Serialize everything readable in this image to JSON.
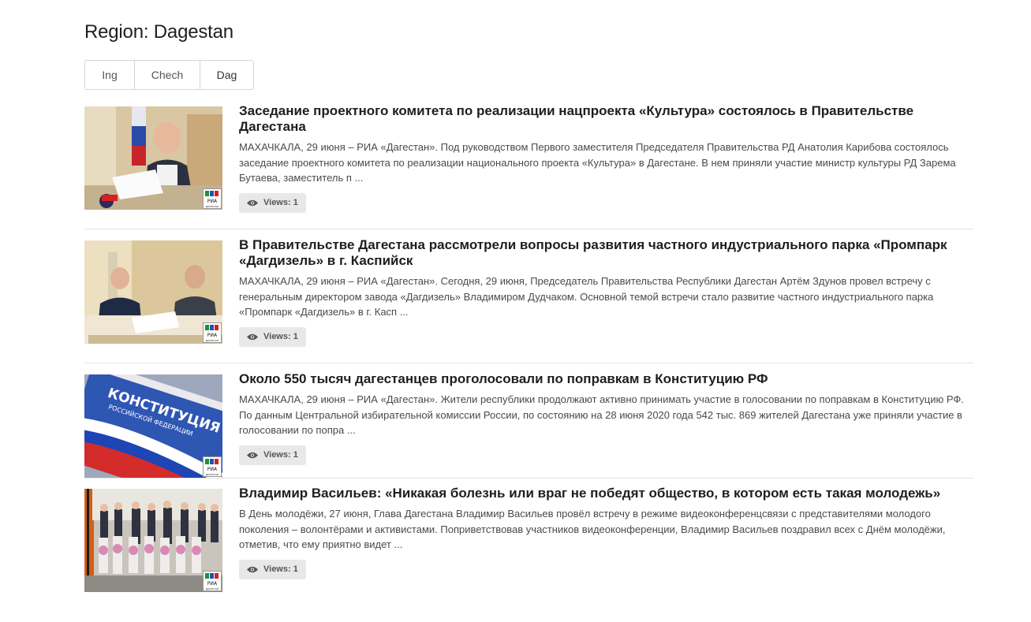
{
  "page": {
    "title": "Region: Dagestan"
  },
  "tabs": [
    {
      "label": "Ing"
    },
    {
      "label": "Chech"
    },
    {
      "label": "Dag"
    }
  ],
  "logo": {
    "colors": [
      "#1d8f3a",
      "#1a56b0",
      "#d72020"
    ],
    "text": "РИА",
    "subtext": "ДАГЕСТАН"
  },
  "news": [
    {
      "title": "Заседание проектного комитета по реализации нацпроекта «Культура» состоялось в Правительстве Дагестана",
      "text": "МАХАЧКАЛА, 29 июня – РИА «Дагестан». Под руководством Первого заместителя Председателя Правительства РД Анатолия Карибова состоялось заседание проектного комитета по реализации национального проекта «Культура» в Дагестане. В нем приняли участие министр культуры РД Зарема Бутаева, заместитель п ...",
      "views": "Views: 1",
      "image": "meeting-photo"
    },
    {
      "title": "В Правительстве Дагестана рассмотрели вопросы развития частного индустриального парка «Промпарк «Дагдизель» в г. Каспийск",
      "text": "МАХАЧКАЛА, 29 июня – РИА «Дагестан». Сегодня, 29 июня, Председатель Правительства Республики Дагестан Артём Здунов провел встречу с генеральным директором завода «Дагдизель» Владимиром Дудчаком.  Основной темой встречи стало развитие частного индустриального парка «Промпарк «Дагдизель» в г. Касп ...",
      "views": "Views: 1",
      "image": "meeting-photo"
    },
    {
      "title": "Около 550 тысяч дагестанцев проголосовали по поправкам в Конституцию РФ",
      "text": "МАХАЧКАЛА, 29 июня – РИА «Дагестан». Жители республики продолжают активно принимать участие в голосовании по поправкам в Конституцию РФ. По данным Центральной избирательной комиссии России, по состоянию на 28 июня 2020 года 542 тыс. 869 жителей Дагестана уже приняли участие в голосовании по попра ...",
      "views": "Views: 1",
      "image": "constitution-book-photo",
      "image_text": [
        "КОНСТИТУЦИЯ",
        "РОССИЙСКОЙ ФЕДЕРАЦИИ"
      ]
    },
    {
      "title": "Владимир Васильев: «Никакая болезнь или враг не победят общество, в котором есть такая молодежь»",
      "text": "В День молодёжи, 27 июня, Глава Дагестана Владимир Васильев провёл встречу в режиме видеоконференцсвязи с представителями молодого поколения – волонтёрами и активистами.  Поприветствовав участников видеоконференции, Владимир Васильев поздравил всех с Днём молодёжи, отметив, что ему приятно видет ...",
      "views": "Views: 1",
      "image": "group-photo"
    }
  ]
}
